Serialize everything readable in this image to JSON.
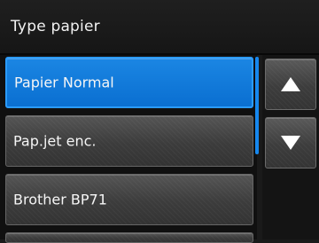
{
  "header": {
    "title": "Type papier"
  },
  "list": {
    "items": [
      {
        "label": "Papier Normal",
        "selected": true
      },
      {
        "label": "Pap.jet enc.",
        "selected": false
      },
      {
        "label": "Brother BP71",
        "selected": false
      }
    ]
  },
  "controls": {
    "up_icon": "triangle-up",
    "down_icon": "triangle-down"
  },
  "colors": {
    "accent": "#0a6fd1",
    "background": "#1a1a1a"
  }
}
